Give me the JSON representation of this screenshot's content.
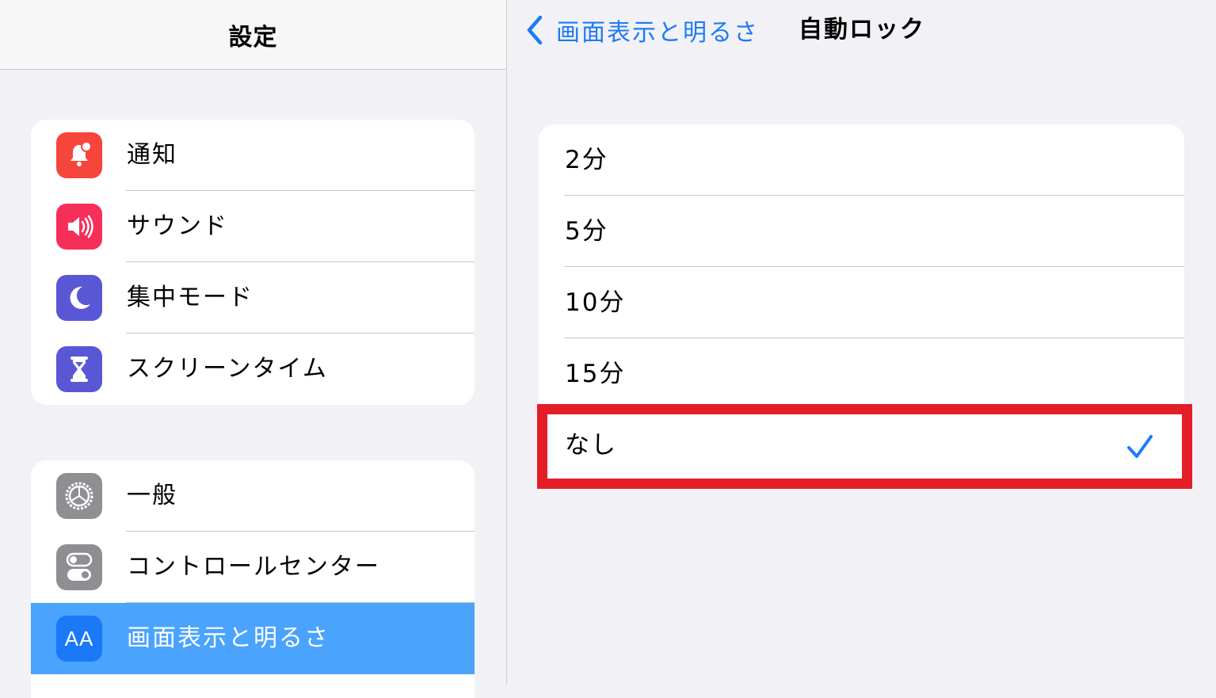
{
  "sidebar": {
    "title": "設定",
    "group1": [
      {
        "label": "通知",
        "icon": "bell-badge-icon",
        "color": "#f6453a"
      },
      {
        "label": "サウンド",
        "icon": "speaker-icon",
        "color": "#f62f5a"
      },
      {
        "label": "集中モード",
        "icon": "moon-icon",
        "color": "#5a57d6"
      },
      {
        "label": "スクリーンタイム",
        "icon": "hourglass-icon",
        "color": "#5a57d6"
      }
    ],
    "group2": [
      {
        "label": "一般",
        "icon": "gear-icon",
        "color": "#8e8e93"
      },
      {
        "label": "コントロールセンター",
        "icon": "toggles-icon",
        "color": "#8e8e93"
      },
      {
        "label": "画面表示と明るさ",
        "icon": "aa-icon",
        "icon_text": "AA",
        "color": "#1a79f6",
        "selected": true
      }
    ]
  },
  "detail": {
    "back_label": "画面表示と明るさ",
    "title": "自動ロック",
    "options": [
      {
        "label": "2分",
        "selected": false
      },
      {
        "label": "5分",
        "selected": false
      },
      {
        "label": "10分",
        "selected": false
      },
      {
        "label": "15分",
        "selected": false
      },
      {
        "label": "なし",
        "selected": true
      }
    ]
  },
  "colors": {
    "accent": "#1d7bf6",
    "selected_row": "#4aa3fc",
    "highlight_box": "#e31e26",
    "background": "#f2f1f6"
  }
}
